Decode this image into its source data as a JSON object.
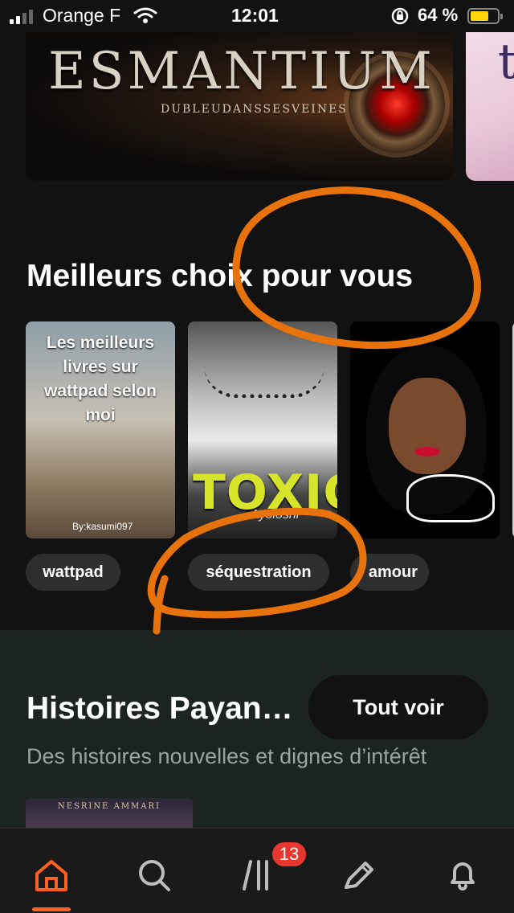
{
  "status_bar": {
    "carrier": "Orange F",
    "time": "12:01",
    "battery": "64 %",
    "battery_level": 0.64
  },
  "banner": {
    "title": "ESMANTIUM",
    "subtitle": "DUBLEUDANSSESVEINES",
    "side_letter": "t"
  },
  "section1": {
    "title": "Meilleurs choix pour vous",
    "books": [
      {
        "cover_title": "Les meilleurs livres sur wattpad selon moi",
        "cover_author": "By:kasumi097"
      },
      {
        "cover_title": "TOXIC",
        "cover_subtitle": "Ayoloshi"
      },
      {
        "cover_title": ""
      }
    ],
    "tags": [
      "wattpad",
      "séquestration",
      "amour"
    ]
  },
  "section2": {
    "title": "Histoires Payan…",
    "see_all": "Tout voir",
    "subtitle": "Des histoires nouvelles et dignes d’intérêt",
    "book_author": "NESRINE AMMARI"
  },
  "bottom_nav": {
    "items": [
      "home-icon",
      "search-icon",
      "library-icon",
      "write-icon",
      "bell-icon"
    ],
    "library_badge": "13",
    "accent": "#ff6122"
  },
  "annotation_color": "#e8730c"
}
